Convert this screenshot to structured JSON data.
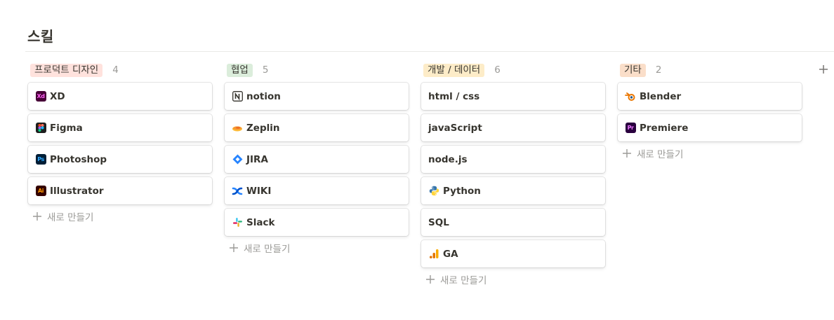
{
  "page": {
    "title": "스킬"
  },
  "board": {
    "new_item_label": "새로 만들기",
    "columns": [
      {
        "tag": "프로덕트 디자인",
        "count": "4",
        "tag_bg": "#ffe2dd",
        "cards": [
          {
            "label": "XD",
            "icon": "adobe-xd-icon"
          },
          {
            "label": "Figma",
            "icon": "figma-icon"
          },
          {
            "label": "Photoshop",
            "icon": "adobe-photoshop-icon"
          },
          {
            "label": "Illustrator",
            "icon": "adobe-illustrator-icon"
          }
        ]
      },
      {
        "tag": "협업",
        "count": "5",
        "tag_bg": "#dbeddb",
        "cards": [
          {
            "label": "notion",
            "icon": "notion-icon"
          },
          {
            "label": "Zeplin",
            "icon": "zeplin-icon"
          },
          {
            "label": "JIRA",
            "icon": "jira-icon"
          },
          {
            "label": "WIKI",
            "icon": "confluence-icon"
          },
          {
            "label": "Slack",
            "icon": "slack-icon"
          }
        ]
      },
      {
        "tag": "개발 / 데이터",
        "count": "6",
        "tag_bg": "#fdecc8",
        "cards": [
          {
            "label": "html / css",
            "icon": ""
          },
          {
            "label": "javaScript",
            "icon": ""
          },
          {
            "label": "node.js",
            "icon": ""
          },
          {
            "label": "Python",
            "icon": "python-icon"
          },
          {
            "label": "SQL",
            "icon": ""
          },
          {
            "label": "GA",
            "icon": "google-analytics-icon"
          }
        ]
      },
      {
        "tag": "기타",
        "count": "2",
        "tag_bg": "#fadec9",
        "cards": [
          {
            "label": "Blender",
            "icon": "blender-icon"
          },
          {
            "label": "Premiere",
            "icon": "adobe-premiere-icon"
          }
        ]
      }
    ]
  }
}
